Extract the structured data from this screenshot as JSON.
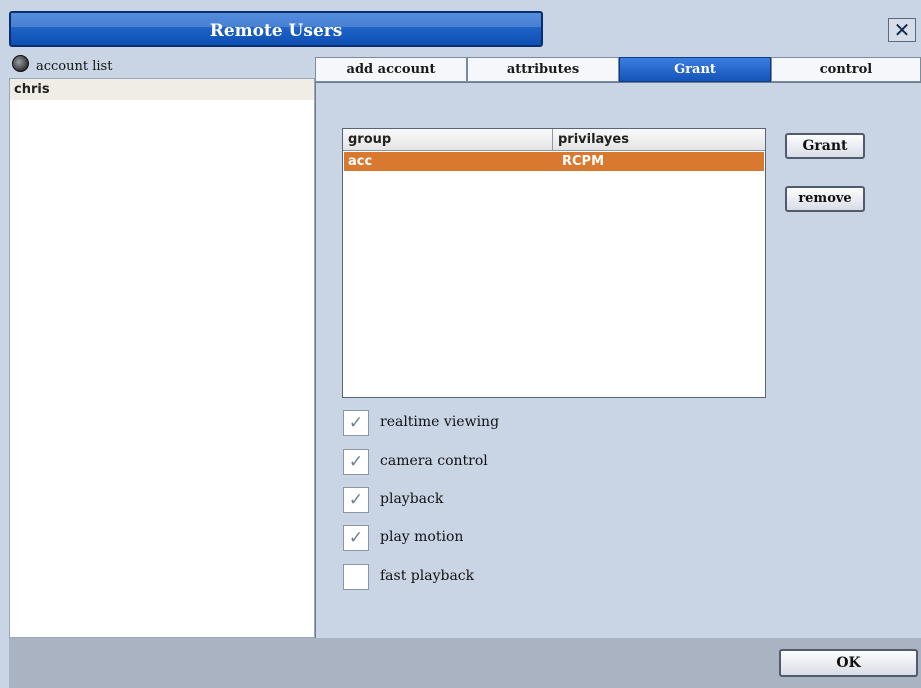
{
  "window": {
    "title": "Remote Users",
    "close_symbol": "✕"
  },
  "account_list": {
    "header": "account list",
    "items": [
      "chris"
    ]
  },
  "tabs": [
    "add account",
    "attributes",
    "Grant",
    "control"
  ],
  "active_tab": "Grant",
  "grant_table": {
    "columns": [
      "group",
      "privilayes"
    ],
    "rows": [
      {
        "group": "acc",
        "privileges": "RCPM"
      }
    ]
  },
  "buttons": {
    "grant": "Grant",
    "remove": "remove",
    "ok": "OK"
  },
  "checkboxes": [
    {
      "label": "realtime viewing",
      "checked": true
    },
    {
      "label": "camera control",
      "checked": true
    },
    {
      "label": "playback",
      "checked": true
    },
    {
      "label": "play motion",
      "checked": true
    },
    {
      "label": "fast playback",
      "checked": false
    }
  ],
  "colors": {
    "title_bar": "#1a5fc7",
    "selected_row": "#d9782f",
    "active_tab": "#2a6bd0",
    "background": "#c9d5e4"
  }
}
